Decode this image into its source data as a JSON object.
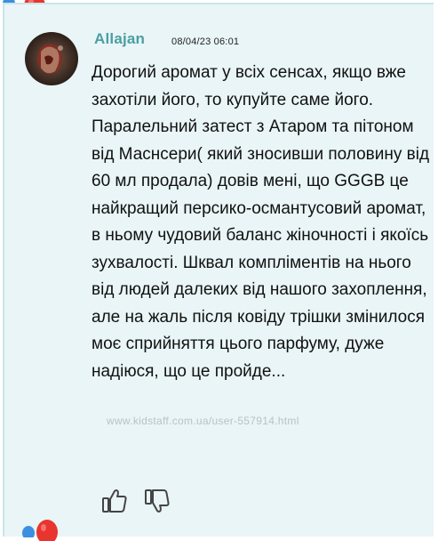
{
  "review": {
    "author": "Allajan",
    "date": "08/04/23 06:01",
    "paragraph_1": "Дорогий аромат у всіх сенсах, якщо вже захотіли його, то купуйте саме його.",
    "paragraph_2": "Паралельний затест з Атаром та пітоном від Маснсери( який зносивши половину від 60 мл продала) довів мені, що GGGB це найкращий персико-османтусовий аромат, в ньому чудовий баланс жіночності і якоїсь зухвалості. Шквал компліментів на нього від людей далеких від нашого захоплення, але на жаль після ковіду трішки змінилося моє сприйняття цього парфуму, дуже надіюся, що це пройде..."
  },
  "watermark": "www.kidstaff.com.ua/user-557914.html",
  "icons": {
    "like": "thumbs-up-icon",
    "dislike": "thumbs-down-icon",
    "decoration": "balloon-icon"
  },
  "colors": {
    "username": "#4a9fa3",
    "card_background": "#e9f5f7",
    "balloon_red": "#e8352f",
    "balloon_blue": "#3d8fe0"
  }
}
